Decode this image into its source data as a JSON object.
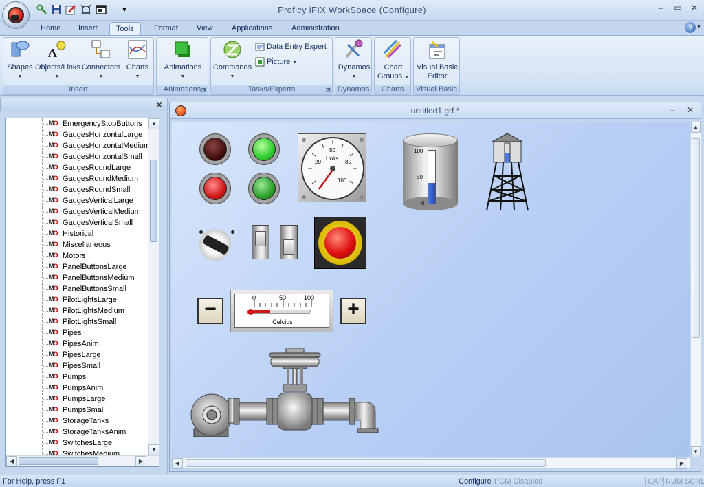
{
  "window": {
    "title": "Proficy iFIX WorkSpace (Configure)",
    "minimize": "–",
    "restore": "▭",
    "close": "✕",
    "help": "?"
  },
  "qat": [
    "key-icon",
    "save-icon",
    "edit-icon",
    "fullscreen-icon",
    "window-icon",
    "customize-icon"
  ],
  "tabs": [
    "Home",
    "Insert",
    "Tools",
    "Format",
    "View",
    "Applications",
    "Administration"
  ],
  "active_tab": "Tools",
  "ribbon": {
    "insert": {
      "label": "Insert",
      "shapes": "Shapes",
      "objects_links": "Objects/Links",
      "connectors": "Connectors",
      "charts": "Charts"
    },
    "animations": {
      "label": "Animations",
      "animations": "Animations"
    },
    "tasks": {
      "label": "Tasks/Experts",
      "commands": "Commands",
      "data_entry": "Data Entry Expert",
      "picture": "Picture"
    },
    "dynamos": {
      "label": "Dynamos",
      "dynamos": "Dynamos"
    },
    "charts": {
      "label": "Charts",
      "chart_groups_1": "Chart",
      "chart_groups_2": "Groups"
    },
    "vb": {
      "label": "Visual Basic",
      "editor_1": "Visual Basic",
      "editor_2": "Editor"
    }
  },
  "panel": {
    "close": "✕"
  },
  "tree_items": [
    "EmergencyStopButtons",
    "GaugesHorizontalLarge",
    "GaugesHorizontalMedium",
    "GaugesHorizontalSmall",
    "GaugesRoundLarge",
    "GaugesRoundMedium",
    "GaugesRoundSmall",
    "GaugesVerticalLarge",
    "GaugesVerticalMedium",
    "GaugesVerticalSmall",
    "Historical",
    "Miscellaneous",
    "Motors",
    "PanelButtonsLarge",
    "PanelButtonsMedium",
    "PanelButtonsSmall",
    "PilotLightsLarge",
    "PilotLightsMedium",
    "PilotLightsSmall",
    "Pipes",
    "PipesAnim",
    "PipesLarge",
    "PipesSmall",
    "Pumps",
    "PumpsAnim",
    "PumpsLarge",
    "PumpsSmall",
    "StorageTanks",
    "StorageTanksAnim",
    "SwitchesLarge",
    "SwitchesMedium"
  ],
  "tree_icon": {
    "m": "M",
    "o": "O"
  },
  "document": {
    "title": "untitled1.grf *",
    "minimize": "–",
    "close": "✕"
  },
  "canvas": {
    "round_gauge": {
      "unit": "Units",
      "ticks": [
        "20",
        "50",
        "80",
        "100"
      ]
    },
    "tank": {
      "ticks": [
        "100",
        "50",
        "0"
      ],
      "level": 0.38
    },
    "tower_level": 0.5,
    "thermometer": {
      "unit": "Celcius",
      "ticks": [
        "0",
        "50",
        "100"
      ],
      "level": 0.32
    },
    "minus": "−",
    "plus": "+"
  },
  "status": {
    "help": "For Help, press F1",
    "mode": "Configure",
    "pcm": "PCM Disabled",
    "cap": "CAP",
    "num": "NUM",
    "scrl": "SCRL"
  }
}
